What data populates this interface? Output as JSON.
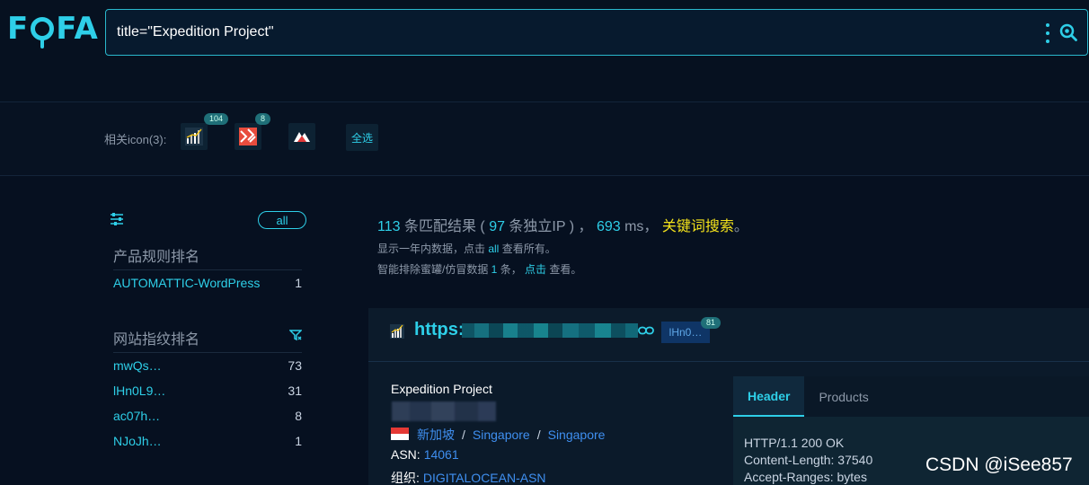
{
  "header": {
    "logo_text": "FOFA",
    "search_value": "title=\"Expedition Project\"",
    "icons": {
      "menu": "more-vertical-icon",
      "search": "search-icon"
    }
  },
  "icon_bar": {
    "label": "相关icon(3):",
    "icons": [
      {
        "name": "chart-favicon",
        "count": "104"
      },
      {
        "name": "red-pattern-favicon",
        "count": "8"
      },
      {
        "name": "mountain-favicon",
        "count": ""
      }
    ],
    "select_all": "全选"
  },
  "sidebar": {
    "all_label": "all",
    "product_title": "产品规则排名",
    "products": [
      {
        "name": "AUTOMATTIC-WordPress",
        "count": "1"
      }
    ],
    "fingerprint_title": "网站指纹排名",
    "fingerprints": [
      {
        "name": "mwQs…",
        "count": "73"
      },
      {
        "name": "lHn0L9…",
        "count": "31"
      },
      {
        "name": "ac07h…",
        "count": "8"
      },
      {
        "name": "NJoJh…",
        "count": "1"
      }
    ]
  },
  "summary": {
    "match_count": "113",
    "match_text": " 条匹配结果 ( ",
    "ip_count": "97",
    "ip_text": " 条独立IP ) ， ",
    "time_ms": "693",
    "ms_text": " ms， ",
    "keyword_link": "关键词搜索",
    "end_punct": "。",
    "line2_pre": "显示一年内数据，点击 ",
    "line2_link": "all",
    "line2_post": " 查看所有。",
    "line3_pre": "智能排除蜜罐/仿冒数据 ",
    "line3_count": "1",
    "line3_mid": " 条， ",
    "line3_link": "点击",
    "line3_post": " 查看。"
  },
  "result": {
    "url_prefix": "https:",
    "tag_label": "lHn0…",
    "tag_count": "81",
    "site_title": "Expedition Project",
    "country": "新加坡",
    "region": "Singapore",
    "city": "Singapore",
    "asn_label": "ASN:",
    "asn_value": "14061",
    "org_label": "组织:",
    "org_value": "DIGITALOCEAN-ASN",
    "tabs": [
      "Header",
      "Products"
    ],
    "header_lines": [
      "HTTP/1.1 200 OK",
      "Content-Length: 37540",
      "Accept-Ranges: bytes"
    ]
  },
  "watermark": "CSDN @iSee857",
  "colors": {
    "accent": "#2ecfe8",
    "background": "#061020",
    "keyword": "#f3e21b",
    "link": "#3f8ff0"
  }
}
